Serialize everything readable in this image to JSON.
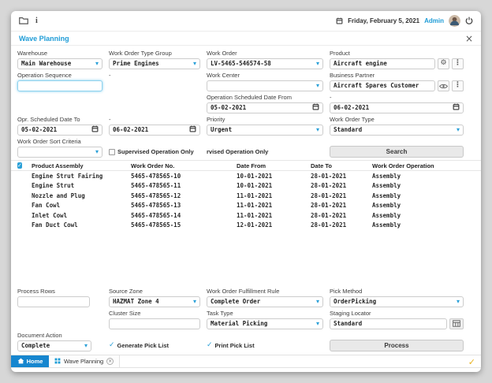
{
  "colors": {
    "accent": "#1e9cd7",
    "tab_active": "#1686cf",
    "corner_check": "#e9b320",
    "button_bg": "#e9e9e9"
  },
  "glyphs": {
    "chevron": "▾",
    "check": "✓",
    "close": "×",
    "kebab": "⋮",
    "gear": "⚙",
    "info": "i",
    "tab_close": "×"
  },
  "topbar": {
    "date": "Friday, February 5, 2021",
    "user": "Admin"
  },
  "titlebar": {
    "title": "Wave Planning"
  },
  "filters": {
    "warehouse": {
      "label": "Warehouse",
      "value": "Main Warehouse"
    },
    "work_order_type_group": {
      "label": "Work Order Type Group",
      "value": "Prime Engines"
    },
    "work_order": {
      "label": "Work Order",
      "value": "LV-5465-546574-58"
    },
    "product": {
      "label": "Product",
      "value": "Aircraft engine"
    },
    "operation_sequence": {
      "label": "Operation Sequence",
      "value": ""
    },
    "dash": "-",
    "work_center": {
      "label": "Work Center",
      "value": ""
    },
    "business_partner": {
      "label": "Business Partner",
      "value": "Aircraft Spares Customer"
    },
    "operation_scheduled_date_from": {
      "label": "Operation Scheduled Date From",
      "value": "05-02-2021",
      "to_label": "-",
      "to_value": "06-02-2021"
    },
    "opr_scheduled_date_to": {
      "label": "Opr. Scheduled Date To",
      "value": "05-02-2021",
      "to_label": "-",
      "to_value": "06-02-2021"
    },
    "priority": {
      "label": "Priority",
      "value": "Urgent"
    },
    "work_order_type": {
      "label": "Work Order Type",
      "value": "Standard"
    },
    "work_order_sort_criteria": {
      "label": "Work Order Sort Criteria",
      "value": ""
    },
    "supervised_operation_only": {
      "label": "Supervised Operation Only"
    },
    "unsupervised_truncated": {
      "label": "rvised Operation Only"
    },
    "search_button": "Search"
  },
  "table": {
    "select_all_checked": true,
    "headers": [
      "Product Assembly",
      "Work Order No.",
      "Date From",
      "Date To",
      "Work Order Operation"
    ],
    "rows": [
      [
        "Engine Strut Fairing",
        "5465-478565-10",
        "10-01-2021",
        "28-01-2021",
        "Assembly"
      ],
      [
        "Engine Strut",
        "5465-478565-11",
        "10-01-2021",
        "28-01-2021",
        "Assembly"
      ],
      [
        "Nozzle and Plug",
        "5465-478565-12",
        "11-01-2021",
        "28-01-2021",
        "Assembly"
      ],
      [
        "Fan Cowl",
        "5465-478565-13",
        "11-01-2021",
        "28-01-2021",
        "Assembly"
      ],
      [
        "Inlet Cowl",
        "5465-478565-14",
        "11-01-2021",
        "28-01-2021",
        "Assembly"
      ],
      [
        "Fan Duct Cowl",
        "5465-478565-15",
        "12-01-2021",
        "28-01-2021",
        "Assembly"
      ]
    ]
  },
  "process": {
    "process_rows": {
      "label": "Process Rows",
      "value": ""
    },
    "source_zone": {
      "label": "Source Zone",
      "value": "HAZMAT Zone 4"
    },
    "fulfillment_rule": {
      "label": "Work Order Fulfillment Rule",
      "value": "Complete Order"
    },
    "pick_method": {
      "label": "Pick Method",
      "value": "OrderPicking"
    },
    "cluster_size": {
      "label": "Cluster Size",
      "value": ""
    },
    "task_type": {
      "label": "Task Type",
      "value": "Material Picking"
    },
    "staging_locator": {
      "label": "Staging Locator",
      "value": "Standard"
    },
    "document_action": {
      "label": "Document Action",
      "value": "Complete"
    },
    "generate_pick_list": {
      "label": "Generate Pick List",
      "checked": true
    },
    "print_pick_list": {
      "label": "Print Pick List",
      "checked": true
    },
    "process_button": "Process"
  },
  "tabbar": {
    "home": "Home",
    "wave_planning": "Wave Planning"
  }
}
